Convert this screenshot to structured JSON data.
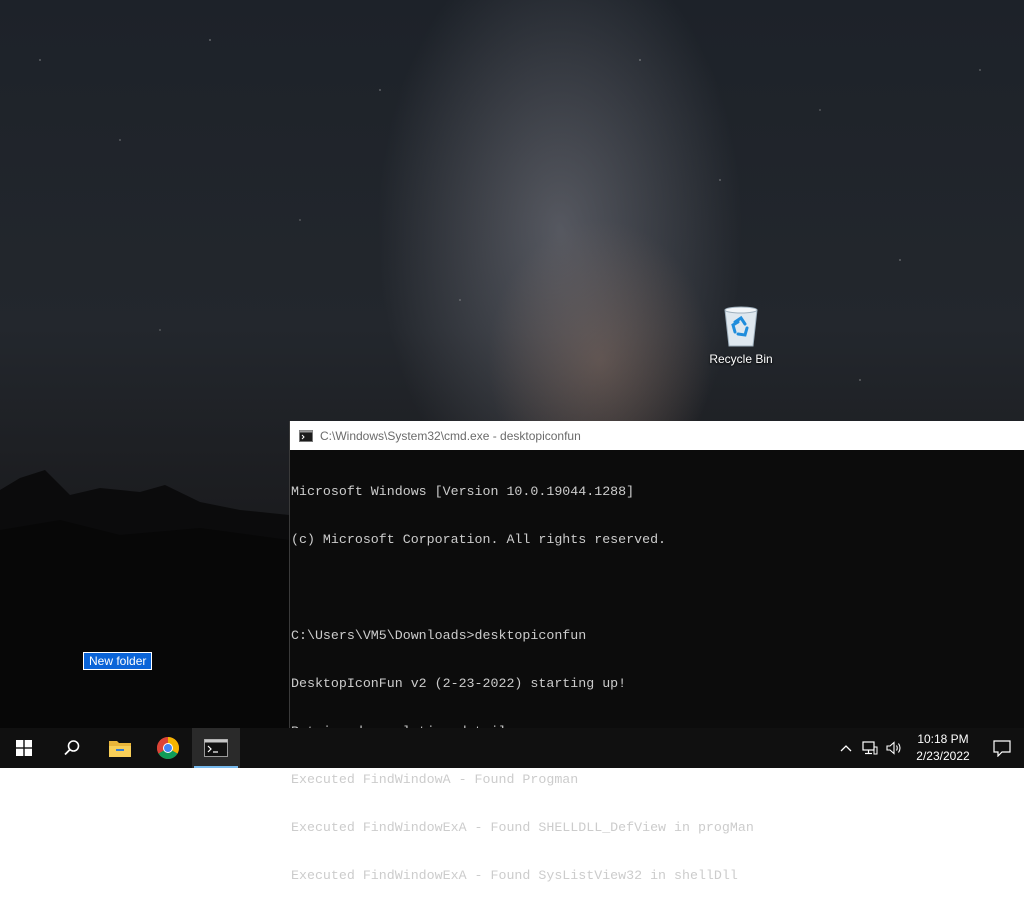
{
  "desktop": {
    "recycle_bin_label": "Recycle Bin",
    "new_folder_label": "New folder"
  },
  "cmd": {
    "title": "C:\\Windows\\System32\\cmd.exe - desktopiconfun",
    "lines": [
      "Microsoft Windows [Version 10.0.19044.1288]",
      "(c) Microsoft Corporation. All rights reserved.",
      "",
      "C:\\Users\\VM5\\Downloads>desktopiconfun",
      "DesktopIconFun v2 (2-23-2022) starting up!",
      "Retrieved resolution details",
      "Executed FindWindowA - Found Progman",
      "Executed FindWindowExA - Found SHELLDLL_DefView in progMan",
      "Executed FindWindowExA - Found SysListView32 in shellDll"
    ]
  },
  "taskbar": {
    "items": [
      "windows-start-icon",
      "search-icon",
      "file-explorer-icon",
      "chrome-icon",
      "cmd-icon"
    ],
    "time": "10:18 PM",
    "date": "2/23/2022",
    "accent": "#76b9ed"
  }
}
